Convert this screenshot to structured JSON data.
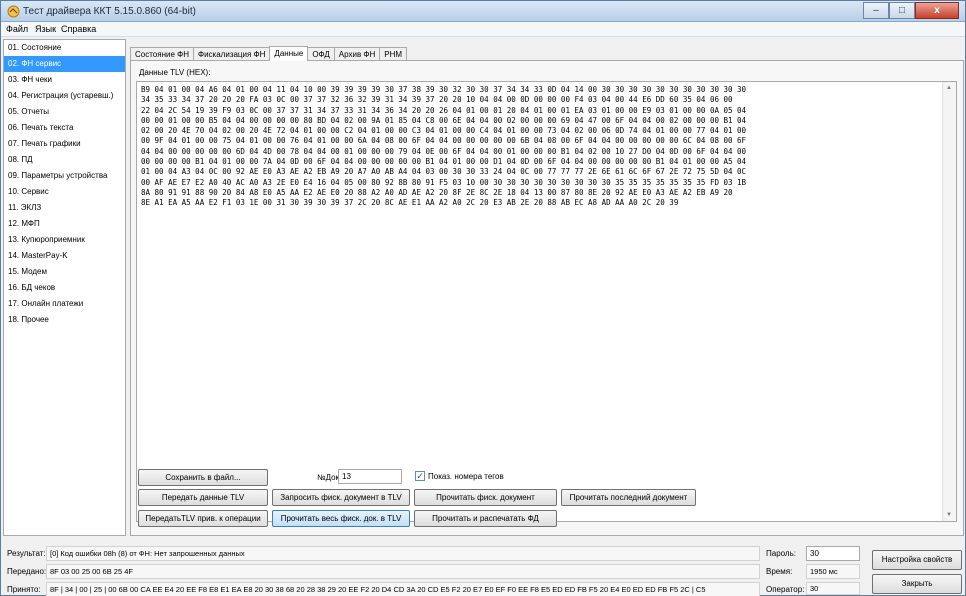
{
  "window": {
    "title": "Тест драйвера ККТ 5.15.0.860 (64-bit)",
    "minimize": "–",
    "maximize": "□",
    "close": "x"
  },
  "menu": [
    "Файл",
    "Язык",
    "Справка"
  ],
  "sidebar": [
    "01. Состояние",
    "02. ФН сервис",
    "03. ФН чеки",
    "04. Регистрация (устаревш.)",
    "05. Отчеты",
    "06. Печать текста",
    "07. Печать графики",
    "08. ПД",
    "09. Параметры устройства",
    "10. Сервис",
    "11. ЭКЛЗ",
    "12. МФП",
    "13. Купюроприемник",
    "14. MasterPay-K",
    "15. Модем",
    "16. БД чеков",
    "17. Онлайн платежи",
    "18. Прочее"
  ],
  "sidebar_selected": 1,
  "tabs": [
    "Состояние ФН",
    "Фискализация ФН",
    "Данные",
    "ОФД",
    "Архив ФН",
    "РНМ"
  ],
  "tab_active": 2,
  "panel": {
    "label": "Данные TLV (HEX):",
    "hex_lines": [
      "B9 04 01 00 04 A6 04 01 00 04 11 04 10 00 39 39 39 39 30 37 38 39 30 32 30 30 37 34 34 33 0D 04 14 00 30 30 30 30 30 30 30 30 30 30 30",
      "34 35 33 34 37 20 20 20 FA 03 0C 00 37 37 32 36 32 39 31 34 39 37 20 20 10 04 04 00 0D 00 00 00 F4 03 04 00 44 E6 DD 60 35 04 06 00",
      "22 04 2C 54 19 39 F9 03 0C 00 37 37 31 34 37 33 31 34 36 34 20 20 26 04 01 00 01 20 04 01 00 01 EA 03 01 00 00 E9 03 01 00 00 0A 05 04",
      "00 00 01 00 00 B5 04 04 00 00 00 00 80 BD 04 02 00 9A 01 85 04 C8 00 6E 04 04 00 02 00 00 00 69 04 47 00 6F 04 04 00 02 00 00 00 B1 04",
      "02 00 20 4E 70 04 02 00 20 4E 72 04 01 00 00 C2 04 01 00 00 C3 04 01 00 00 C4 04 01 00 00 73 04 02 00 06 0D 74 04 01 00 00 77 04 01 00",
      "00 9F 04 01 00 00 75 04 01 00 00 76 04 01 00 00 6A 04 08 00 6F 04 04 00 00 00 00 00 6B 04 08 00 6F 04 04 00 00 00 00 00 6C 04 08 00 6F",
      "04 04 00 00 00 00 00 6D 04 4D 00 78 04 04 00 01 00 00 00 79 04 0E 00 6F 04 04 00 01 00 00 00 B1 04 02 00 10 27 D0 04 0D 00 6F 04 04 00",
      "00 00 00 00 B1 04 01 00 00 7A 04 0D 00 6F 04 04 00 00 00 00 00 B1 04 01 00 00 D1 04 0D 00 6F 04 04 00 00 00 00 00 B1 04 01 00 00 A5 04",
      "01 00 04 A3 04 0C 00 92 AE E0 A3 AE A2 EB A9 20 A7 A0 AB A4 04 03 00 30 30 33 24 04 0C 00 77 77 77 2E 6E 61 6C 6F 67 2E 72 75 5D 04 0C",
      "00 AF AE E7 E2 A0 40 AC A0 A3 2E E0 E4 16 04 05 00 80 92 8B 80 91 F5 03 10 00 30 30 30 30 30 30 30 30 30 35 35 35 35 35 35 35 FD 03 1B",
      "8A 80 91 91 88 90 20 84 A8 E0 A5 AA E2 AE E0 20 88 A2 A0 AD AE A2 20 8F 2E 8C 2E 18 04 13 00 87 80 8E 20 92 AE E0 A3 AE A2 EB A9 20",
      "8E A1 EA A5 AA E2 F1 03 1E 00 31 30 39 30 39 37 2C 20 8C AE E1 AA A2 A0 2C 20 E3 AB 2E 20 88 AB EC A8 AD AA A0 2C 20 39"
    ],
    "buttons": {
      "save_to_file": "Сохранить в файл...",
      "send_tlv": "Передать данные TLV",
      "request_fisc_doc_tlv": "Запросить фиск. документ в TLV",
      "read_fisc_doc": "Прочитать фиск. документ",
      "read_last_doc": "Прочитать последний документ",
      "send_tlv_op": "ПередатьTLV прив. к операции",
      "read_all_fisc_doc_tlv": "Прочитать весь фиск. док. в TLV",
      "read_print_fd": "Прочитать и распечатать ФД"
    },
    "doc_no_label": "№Док.",
    "doc_no_value": "13",
    "show_tag_numbers_label": "Показ. номера тегов",
    "show_tag_numbers_checked": "✓"
  },
  "status": {
    "result_label": "Результат:",
    "result_value": "[0] Код ошибки 08h (8) от ФН: Нет запрошенных данных",
    "sent_label": "Передано:",
    "sent_value": "8F 03 00 25 00 6B 25 4F",
    "received_label": "Принято:",
    "received_value": "8F | 34 | 00 | 25 | 00 6B 00 CA EE E4 20 EE F8 E8 E1 EA E8 20 30 38 68 20 28 38 29 20 EE F2 20 D4 CD 3A 20 CD E5 F2 20 E7 E0 EF F0 EE F8 E5 ED ED FB F5 20 E4 E0 ED ED FB F5 2C | C5",
    "password_label": "Пароль:",
    "password_value": "30",
    "time_label": "Время:",
    "time_value": "1950 мс",
    "operator_label": "Оператор:",
    "operator_value": "30",
    "settings_button": "Настройка свойств",
    "close_button": "Закрыть"
  }
}
